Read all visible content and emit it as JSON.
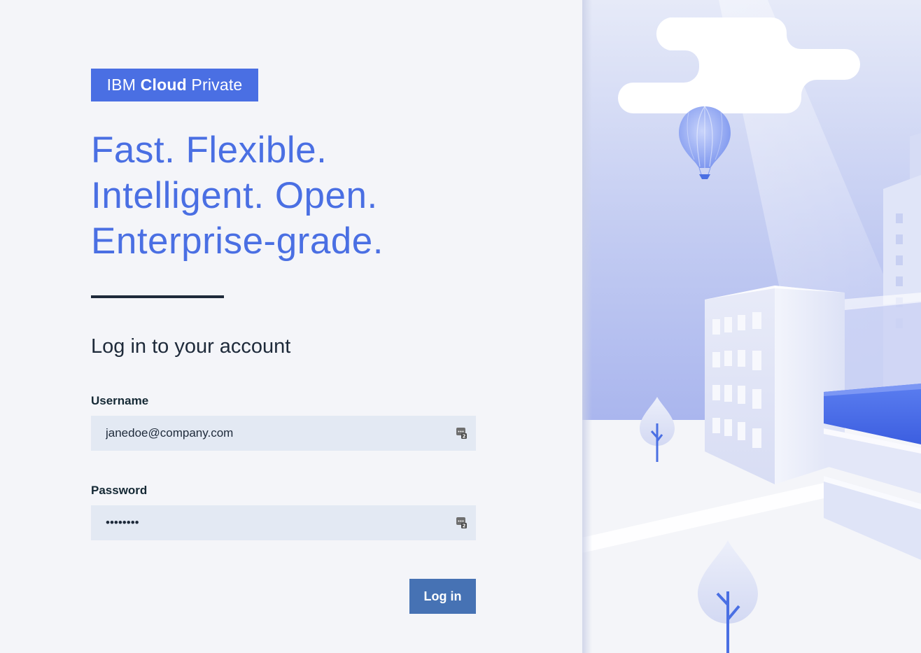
{
  "brand": {
    "prefix": "IBM",
    "bold": "Cloud",
    "suffix": "Private",
    "color": "#4a6fe3"
  },
  "headline": {
    "line1": "Fast. Flexible.",
    "line2": "Intelligent. Open.",
    "line3": "Enterprise-grade."
  },
  "login": {
    "title": "Log in to your account",
    "username_label": "Username",
    "username_value": "janedoe@company.com",
    "password_label": "Password",
    "password_value": "password",
    "submit_label": "Log in",
    "button_color": "#4672b4"
  },
  "illustration": {
    "name": "city-balloon-illustration",
    "icons": [
      "cloud-icon",
      "hot-air-balloon-icon",
      "building-icon",
      "tree-icon"
    ]
  }
}
